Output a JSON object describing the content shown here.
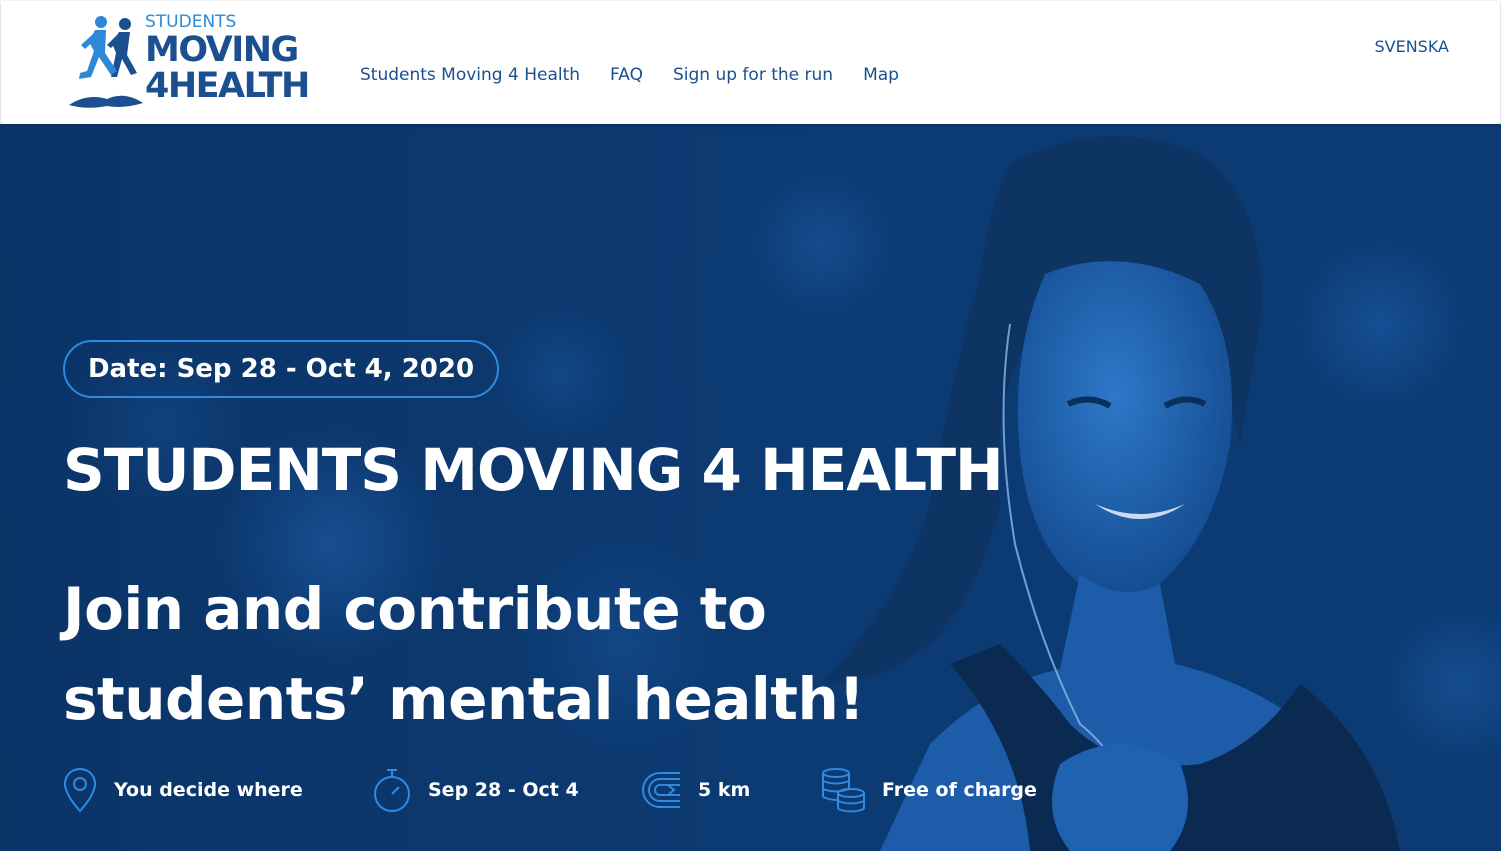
{
  "header": {
    "logo": {
      "line_small": "STUDENTS",
      "line1": "MOVING",
      "line2": "4HEALTH"
    },
    "nav": [
      {
        "label": "Students Moving 4 Health"
      },
      {
        "label": "FAQ"
      },
      {
        "label": "Sign up for the run"
      },
      {
        "label": "Map"
      }
    ],
    "language_label": "SVENSKA"
  },
  "hero": {
    "date_label": "Date: Sep 28 - Oct 4, 2020",
    "title": "STUDENTS MOVING 4 HEALTH",
    "subtitle": "Join and contribute to students’ mental health!",
    "features": [
      {
        "icon": "location-pin-icon",
        "label": "You decide where"
      },
      {
        "icon": "stopwatch-icon",
        "label": "Sep 28 - Oct 4"
      },
      {
        "icon": "running-track-icon",
        "label": "5 km"
      },
      {
        "icon": "coins-icon",
        "label": "Free of charge"
      }
    ]
  },
  "colors": {
    "brand_dark_blue": "#1c4f8f",
    "brand_light_blue": "#2d88d6",
    "hero_overlay": "#0b3a72",
    "accent_outline": "#2e8be0",
    "text_on_hero": "#ffffff"
  }
}
